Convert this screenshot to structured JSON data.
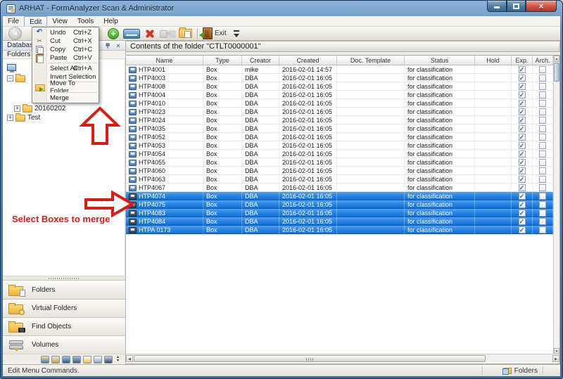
{
  "window": {
    "title": "ARHAT - FormAnalyzer Scan & Administrator"
  },
  "colors": {
    "selection_blue": "#1a7ad4",
    "annotation_red": "#dc1a16",
    "titlebar_blue": "#4a78a8"
  },
  "menu_bar": {
    "items": [
      "File",
      "Edit",
      "View",
      "Tools",
      "Help"
    ],
    "open": "Edit"
  },
  "edit_menu": [
    {
      "label": "Undo",
      "shortcut": "Ctrl+Z",
      "icon": "undo-icon"
    },
    {
      "label": "Cut",
      "shortcut": "Ctrl+X",
      "icon": "scissors-icon"
    },
    {
      "label": "Copy",
      "shortcut": "Ctrl+C",
      "icon": "copy-icon"
    },
    {
      "label": "Paste",
      "shortcut": "Ctrl+V",
      "icon": "paste-icon"
    },
    {
      "separator": true
    },
    {
      "label": "Select All",
      "shortcut": "Ctrl+A"
    },
    {
      "label": "Invert Selection"
    },
    {
      "separator": true
    },
    {
      "label": "Move To Folder...",
      "icon": "folder-move2-icon"
    },
    {
      "separator": true
    },
    {
      "label": "Merge"
    }
  ],
  "toolbar": {
    "buttons": [
      {
        "name": "back-button",
        "icon": "back-icon",
        "disabled": true
      },
      {
        "name": "add-button",
        "icon": "add-icon",
        "gap_before": true
      },
      {
        "name": "scan-button",
        "icon": "scanner-icon"
      },
      {
        "name": "delete-button",
        "icon": "delete-icon"
      },
      {
        "name": "link-button",
        "icon": "link-icon",
        "disabled": true
      },
      {
        "name": "move-to-folder-button",
        "icon": "move-folder-icon"
      },
      {
        "sep": true
      },
      {
        "name": "exit-button",
        "icon": "exit-icon",
        "label": "Exit"
      },
      {
        "name": "toolbar-overflow-button",
        "icon": "chevron-down-icon"
      }
    ]
  },
  "sidebar": {
    "panel_title": "Database",
    "section_title": "Folders",
    "tree": [
      {
        "label": "",
        "icon": "computer-icon",
        "indent": 0
      },
      {
        "label": "",
        "icon": "folder-icon",
        "expander": "minus",
        "indent": 1
      },
      {
        "label": "20160202",
        "icon": "folder-icon",
        "expander": "plus",
        "indent": 2
      },
      {
        "label": "Test",
        "icon": "folder-icon",
        "expander": "plus",
        "indent": 1
      }
    ],
    "nav_items": [
      {
        "label": "Folders",
        "icon": "folders-icon"
      },
      {
        "label": "Virtual Folders",
        "icon": "virtual-folders-icon"
      },
      {
        "label": "Find Objects",
        "icon": "find-objects-icon"
      },
      {
        "label": "Volumes",
        "icon": "volumes-icon"
      }
    ],
    "strip_icons": [
      "user-permissions-icon",
      "database-icon",
      "monitor-icon",
      "monitor-settings-icon",
      "report-warning-icon",
      "document-settings-icon",
      "save-icon"
    ]
  },
  "annotation": {
    "text": "Select Boxes to merge"
  },
  "content": {
    "caption": "Contents of the folder \"CTLT0000001\"",
    "columns": [
      "Name",
      "Type",
      "Creator",
      "Created",
      "Doc. Template",
      "Status",
      "Hold",
      "Exp.",
      "Arch."
    ],
    "rows": [
      {
        "name": "HTP4001",
        "type": "Box",
        "creator": "mike",
        "created": "2016-02-01 14:57",
        "doc_template": "",
        "status": "for classification",
        "hold": "",
        "exp": true,
        "arch": false,
        "selected": false
      },
      {
        "name": "HTP4003",
        "type": "Box",
        "creator": "DBA",
        "created": "2016-02-01 16:05",
        "doc_template": "",
        "status": "for classification",
        "hold": "",
        "exp": true,
        "arch": false,
        "selected": false
      },
      {
        "name": "HTP4008",
        "type": "Box",
        "creator": "DBA",
        "created": "2016-02-01 16:05",
        "doc_template": "",
        "status": "for classification",
        "hold": "",
        "exp": true,
        "arch": false,
        "selected": false
      },
      {
        "name": "HTP4004",
        "type": "Box",
        "creator": "DBA",
        "created": "2016-02-01 16:05",
        "doc_template": "",
        "status": "for classification",
        "hold": "",
        "exp": true,
        "arch": false,
        "selected": false
      },
      {
        "name": "HTP4010",
        "type": "Box",
        "creator": "DBA",
        "created": "2016-02-01 16:05",
        "doc_template": "",
        "status": "for classification",
        "hold": "",
        "exp": true,
        "arch": false,
        "selected": false
      },
      {
        "name": "HTP4023",
        "type": "Box",
        "creator": "DBA",
        "created": "2016-02-01 16:05",
        "doc_template": "",
        "status": "for classification",
        "hold": "",
        "exp": true,
        "arch": false,
        "selected": false
      },
      {
        "name": "HTP4024",
        "type": "Box",
        "creator": "DBA",
        "created": "2016-02-01 16:05",
        "doc_template": "",
        "status": "for classification",
        "hold": "",
        "exp": true,
        "arch": false,
        "selected": false
      },
      {
        "name": "HTP4035",
        "type": "Box",
        "creator": "DBA",
        "created": "2016-02-01 16:05",
        "doc_template": "",
        "status": "for classification",
        "hold": "",
        "exp": true,
        "arch": false,
        "selected": false
      },
      {
        "name": "HTP4052",
        "type": "Box",
        "creator": "DBA",
        "created": "2016-02-01 16:05",
        "doc_template": "",
        "status": "for classification",
        "hold": "",
        "exp": true,
        "arch": false,
        "selected": false
      },
      {
        "name": "HTP4053",
        "type": "Box",
        "creator": "DBA",
        "created": "2016-02-01 16:05",
        "doc_template": "",
        "status": "for classification",
        "hold": "",
        "exp": true,
        "arch": false,
        "selected": false
      },
      {
        "name": "HTP4054",
        "type": "Box",
        "creator": "DBA",
        "created": "2016-02-01 16:05",
        "doc_template": "",
        "status": "for classification",
        "hold": "",
        "exp": true,
        "arch": false,
        "selected": false
      },
      {
        "name": "HTP4055",
        "type": "Box",
        "creator": "DBA",
        "created": "2016-02-01 16:05",
        "doc_template": "",
        "status": "for classification",
        "hold": "",
        "exp": true,
        "arch": false,
        "selected": false
      },
      {
        "name": "HTP4060",
        "type": "Box",
        "creator": "DBA",
        "created": "2016-02-01 16:05",
        "doc_template": "",
        "status": "for classification",
        "hold": "",
        "exp": true,
        "arch": false,
        "selected": false
      },
      {
        "name": "HTP4063",
        "type": "Box",
        "creator": "DBA",
        "created": "2016-02-01 16:05",
        "doc_template": "",
        "status": "for classification",
        "hold": "",
        "exp": true,
        "arch": false,
        "selected": false
      },
      {
        "name": "HTP4067",
        "type": "Box",
        "creator": "DBA",
        "created": "2016-02-01 16:05",
        "doc_template": "",
        "status": "for classification",
        "hold": "",
        "exp": true,
        "arch": false,
        "selected": false
      },
      {
        "name": "HTP4074",
        "type": "Box",
        "creator": "DBA",
        "created": "2016-02-01 16:05",
        "doc_template": "",
        "status": "for classification",
        "hold": "",
        "exp": true,
        "arch": false,
        "selected": true
      },
      {
        "name": "HTP4075",
        "type": "Box",
        "creator": "DBA",
        "created": "2016-02-01 16:05",
        "doc_template": "",
        "status": "for classification",
        "hold": "",
        "exp": true,
        "arch": false,
        "selected": true
      },
      {
        "name": "HTP4083",
        "type": "Box",
        "creator": "DBA",
        "created": "2016-02-01 16:05",
        "doc_template": "",
        "status": "for classification",
        "hold": "",
        "exp": true,
        "arch": false,
        "selected": true
      },
      {
        "name": "HTP4084",
        "type": "Box",
        "creator": "DBA",
        "created": "2016-02-01 16:05",
        "doc_template": "",
        "status": "for classification",
        "hold": "",
        "exp": true,
        "arch": false,
        "selected": true
      },
      {
        "name": "HTPA 0173",
        "type": "Box",
        "creator": "DBA",
        "created": "2016-02-01 16:05",
        "doc_template": "",
        "status": "for classification",
        "hold": "",
        "exp": true,
        "arch": false,
        "selected": true
      }
    ]
  },
  "status_bar": {
    "left": "Edit Menu Commands.",
    "right": "Folders"
  }
}
